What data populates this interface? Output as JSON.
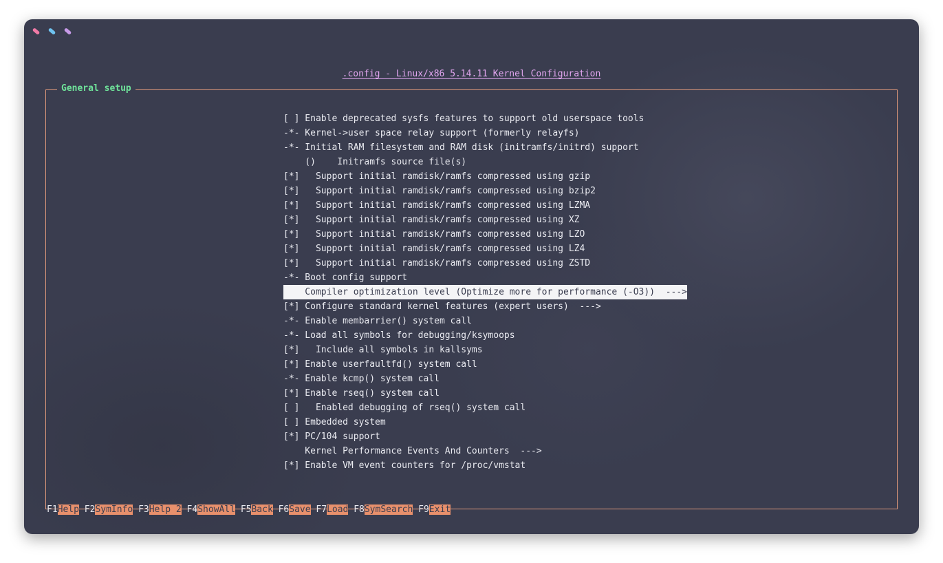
{
  "colors": {
    "window_bg": "#3a3d4f",
    "frame_border": "#e39b7c",
    "title_color": "#e2a6f0",
    "section_title_color": "#6fe39a",
    "text": "#e9eaf0",
    "highlight_bg": "#f4f4f6",
    "fn_label_bg": "#e8906c",
    "dot_colors": [
      "#f07aa6",
      "#6fc3f0",
      "#c79ae8"
    ]
  },
  "window": {
    "title": ".config - Linux/x86 5.14.11 Kernel Configuration",
    "section_title": "General setup"
  },
  "menu": {
    "selected_index": 14,
    "items": [
      {
        "text": "[ ] Enable deprecated sysfs features to support old userspace tools"
      },
      {
        "text": "-*- Kernel->user space relay support (formerly relayfs)"
      },
      {
        "text": "-*- Initial RAM filesystem and RAM disk (initramfs/initrd) support"
      },
      {
        "text": "    ()    Initramfs source file(s)"
      },
      {
        "text": "[*]   Support initial ramdisk/ramfs compressed using gzip"
      },
      {
        "text": "[*]   Support initial ramdisk/ramfs compressed using bzip2"
      },
      {
        "text": "[*]   Support initial ramdisk/ramfs compressed using LZMA"
      },
      {
        "text": "[*]   Support initial ramdisk/ramfs compressed using XZ"
      },
      {
        "text": "[*]   Support initial ramdisk/ramfs compressed using LZO"
      },
      {
        "text": "[*]   Support initial ramdisk/ramfs compressed using LZ4"
      },
      {
        "text": "[*]   Support initial ramdisk/ramfs compressed using ZSTD"
      },
      {
        "text": "-*- Boot config support"
      },
      {
        "text": "    Compiler optimization level (Optimize more for performance (-O3))  --->"
      },
      {
        "text": "[*] Configure standard kernel features (expert users)  --->"
      },
      {
        "text": "-*- Enable membarrier() system call"
      },
      {
        "text": "-*- Load all symbols for debugging/ksymoops"
      },
      {
        "text": "[*]   Include all symbols in kallsyms"
      },
      {
        "text": "[*] Enable userfaultfd() system call"
      },
      {
        "text": "-*- Enable kcmp() system call"
      },
      {
        "text": "[*] Enable rseq() system call"
      },
      {
        "text": "[ ]   Enabled debugging of rseq() system call"
      },
      {
        "text": "[ ] Embedded system"
      },
      {
        "text": "[*] PC/104 support"
      },
      {
        "text": "    Kernel Performance Events And Counters  --->"
      },
      {
        "text": "[*] Enable VM event counters for /proc/vmstat"
      }
    ]
  },
  "function_keys": [
    {
      "key": "F1",
      "label": "Help"
    },
    {
      "key": "F2",
      "label": "SymInfo"
    },
    {
      "key": "F3",
      "label": "Help 2"
    },
    {
      "key": "F4",
      "label": "ShowAll"
    },
    {
      "key": "F5",
      "label": "Back"
    },
    {
      "key": "F6",
      "label": "Save"
    },
    {
      "key": "F7",
      "label": "Load"
    },
    {
      "key": "F8",
      "label": "SymSearch"
    },
    {
      "key": "F9",
      "label": "Exit"
    }
  ]
}
